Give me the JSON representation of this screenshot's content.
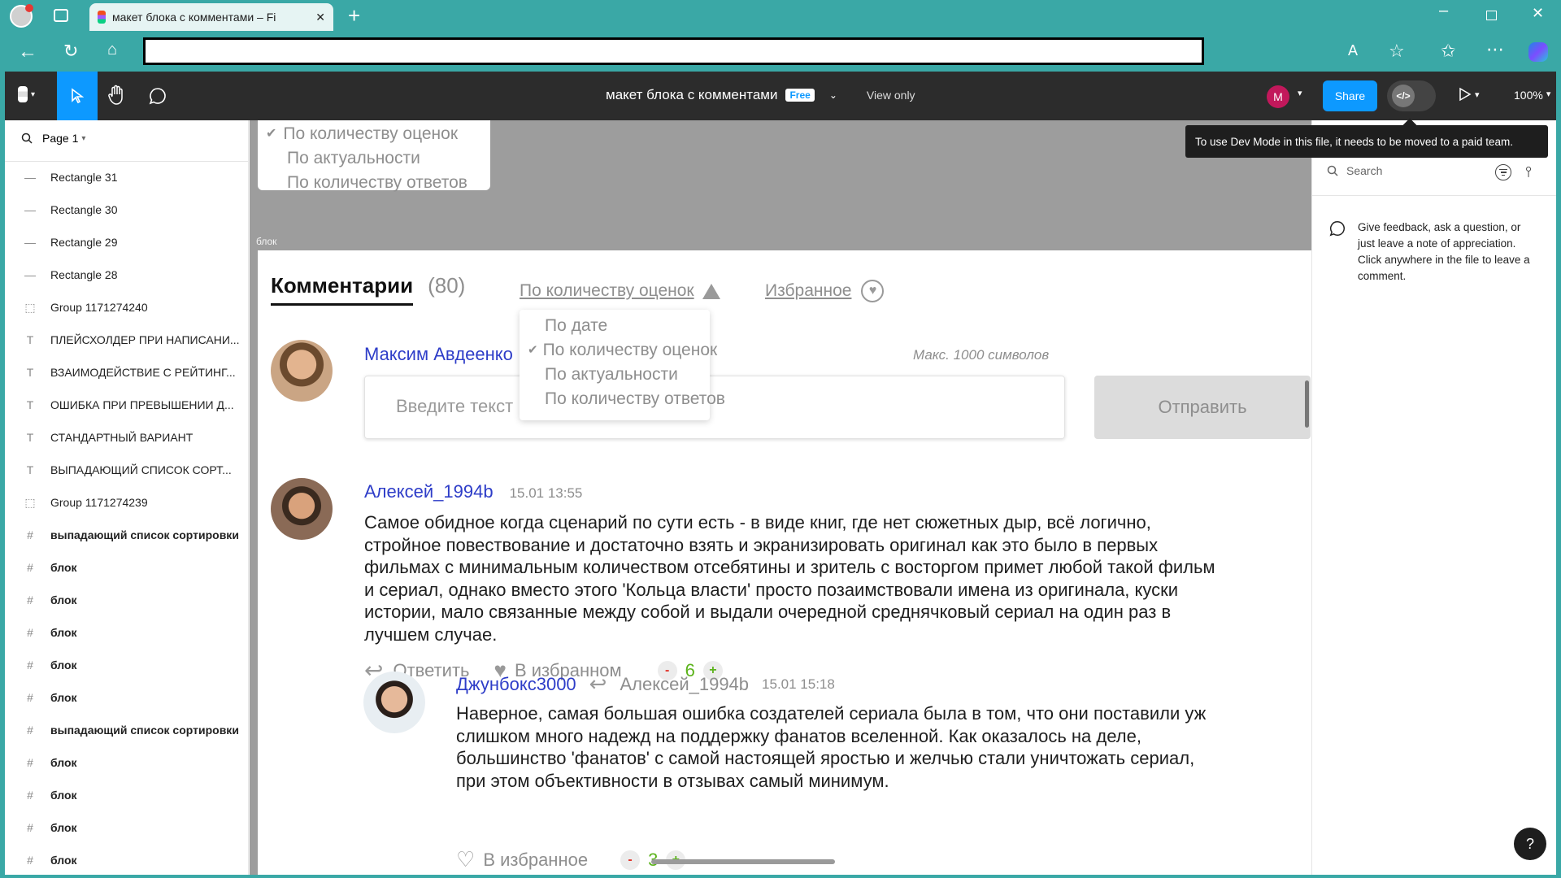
{
  "browser": {
    "tab_title": "макет блока с комментами – Fi",
    "tab_close": "✕",
    "new_tab": "+"
  },
  "figma": {
    "file_name": "макет блока с комментами",
    "plan_badge": "Free",
    "mode": "View only",
    "user_initial": "M",
    "share_label": "Share",
    "zoom": "100%",
    "devmode_tooltip": "To use Dev Mode in this file, it needs to be moved to a paid team.",
    "page_label": "Page 1",
    "frame_label": "блок",
    "layers": [
      {
        "icon": "line-icon",
        "name": "Rectangle 31",
        "bold": false
      },
      {
        "icon": "line-icon",
        "name": "Rectangle 30",
        "bold": false
      },
      {
        "icon": "line-icon",
        "name": "Rectangle 29",
        "bold": false
      },
      {
        "icon": "line-icon",
        "name": "Rectangle 28",
        "bold": false
      },
      {
        "icon": "group-icon",
        "name": "Group 1171274240",
        "bold": false
      },
      {
        "icon": "text-icon",
        "name": "ПЛЕЙСХОЛДЕР ПРИ НАПИСАНИ...",
        "bold": false
      },
      {
        "icon": "text-icon",
        "name": "ВЗАИМОДЕЙСТВИЕ С РЕЙТИНГ...",
        "bold": false
      },
      {
        "icon": "text-icon",
        "name": "ОШИБКА ПРИ ПРЕВЫШЕНИИ Д...",
        "bold": false
      },
      {
        "icon": "text-icon",
        "name": "СТАНДАРТНЫЙ ВАРИАНТ",
        "bold": false
      },
      {
        "icon": "text-icon",
        "name": "ВЫПАДАЮЩИЙ СПИСОК СОРТ...",
        "bold": false
      },
      {
        "icon": "group-icon",
        "name": "Group 1171274239",
        "bold": false
      },
      {
        "icon": "frame-icon",
        "name": "выпадающий список сортировки",
        "bold": true
      },
      {
        "icon": "frame-icon",
        "name": "блок",
        "bold": true
      },
      {
        "icon": "frame-icon",
        "name": "блок",
        "bold": true
      },
      {
        "icon": "frame-icon",
        "name": "блок",
        "bold": true
      },
      {
        "icon": "frame-icon",
        "name": "блок",
        "bold": true
      },
      {
        "icon": "frame-icon",
        "name": "блок",
        "bold": true
      },
      {
        "icon": "frame-icon",
        "name": "выпадающий список сортировки",
        "bold": true
      },
      {
        "icon": "frame-icon",
        "name": "блок",
        "bold": true
      },
      {
        "icon": "frame-icon",
        "name": "блок",
        "bold": true
      },
      {
        "icon": "frame-icon",
        "name": "блок",
        "bold": true
      },
      {
        "icon": "frame-icon",
        "name": "блок",
        "bold": true
      }
    ],
    "comments_panel": {
      "search_placeholder": "Search",
      "hint": "Give feedback, ask a question, or just leave a note of appreciation. Click anywhere in the file to leave a comment."
    },
    "help": "?"
  },
  "design": {
    "top_dropdown": {
      "options": [
        "По количеству оценок",
        "По актуальности",
        "По количеству ответов"
      ]
    },
    "comments_title": "Комментарии",
    "comments_count": "(80)",
    "sort_label": "По количеству оценок",
    "favorites_label": "Избранное",
    "sort_dropdown": {
      "options": [
        "По дате",
        "По количеству оценок",
        "По актуальности",
        "По количеству ответов"
      ],
      "selected_index": 1
    },
    "composer": {
      "author": "Максим Авдеенко",
      "limit_hint": "Макс. 1000 символов",
      "placeholder": "Введите текст",
      "send_label": "Отправить"
    },
    "comment1": {
      "author": "Алексей_1994b",
      "time": "15.01 13:55",
      "text_lines": [
        "Самое обидное когда сценарий по сути есть - в виде книг, где нет сюжетных дыр, всё логично,",
        "стройное повествование и достаточно взять и экранизировать оригинал как это было в первых",
        "фильмах с минимальным количеством отсебятины и зритель с восторгом примет любой такой фильм",
        "и сериал, однако вместо этого 'Кольца власти' просто позаимствовали имена из оригинала, куски",
        "истории, мало связанные между собой и выдали очередной среднячковый сериал на один раз в",
        "лучшем случае."
      ],
      "reply_label": "Ответить",
      "fav_label": "В избранном",
      "minus": "-",
      "rating": "6",
      "plus": "+"
    },
    "reply1": {
      "author": "Джунбокс3000",
      "reply_to": "Алексей_1994b",
      "time": "15.01 15:18",
      "text_lines": [
        "Наверное, самая большая ошибка создателей сериала была в том, что они поставили уж",
        "слишком много надежд на поддержку фанатов вселенной. Как оказалось на деле,",
        "большинство 'фанатов' с самой настоящей яростью и желчью стали уничтожать сериал,",
        "при этом объективности в отзывах самый минимум."
      ],
      "fav_label": "В избранное",
      "minus": "-",
      "rating": "3",
      "plus": "+"
    }
  },
  "colors": {
    "browser_teal": "#3aa8a6",
    "figma_topbar": "#2c2c2c",
    "accent_blue": "#0d99ff",
    "link_blue": "#2e3dc8",
    "rating_green": "#5bb31b",
    "minus_red": "#e0352b",
    "user_avatar": "#c2185b"
  }
}
